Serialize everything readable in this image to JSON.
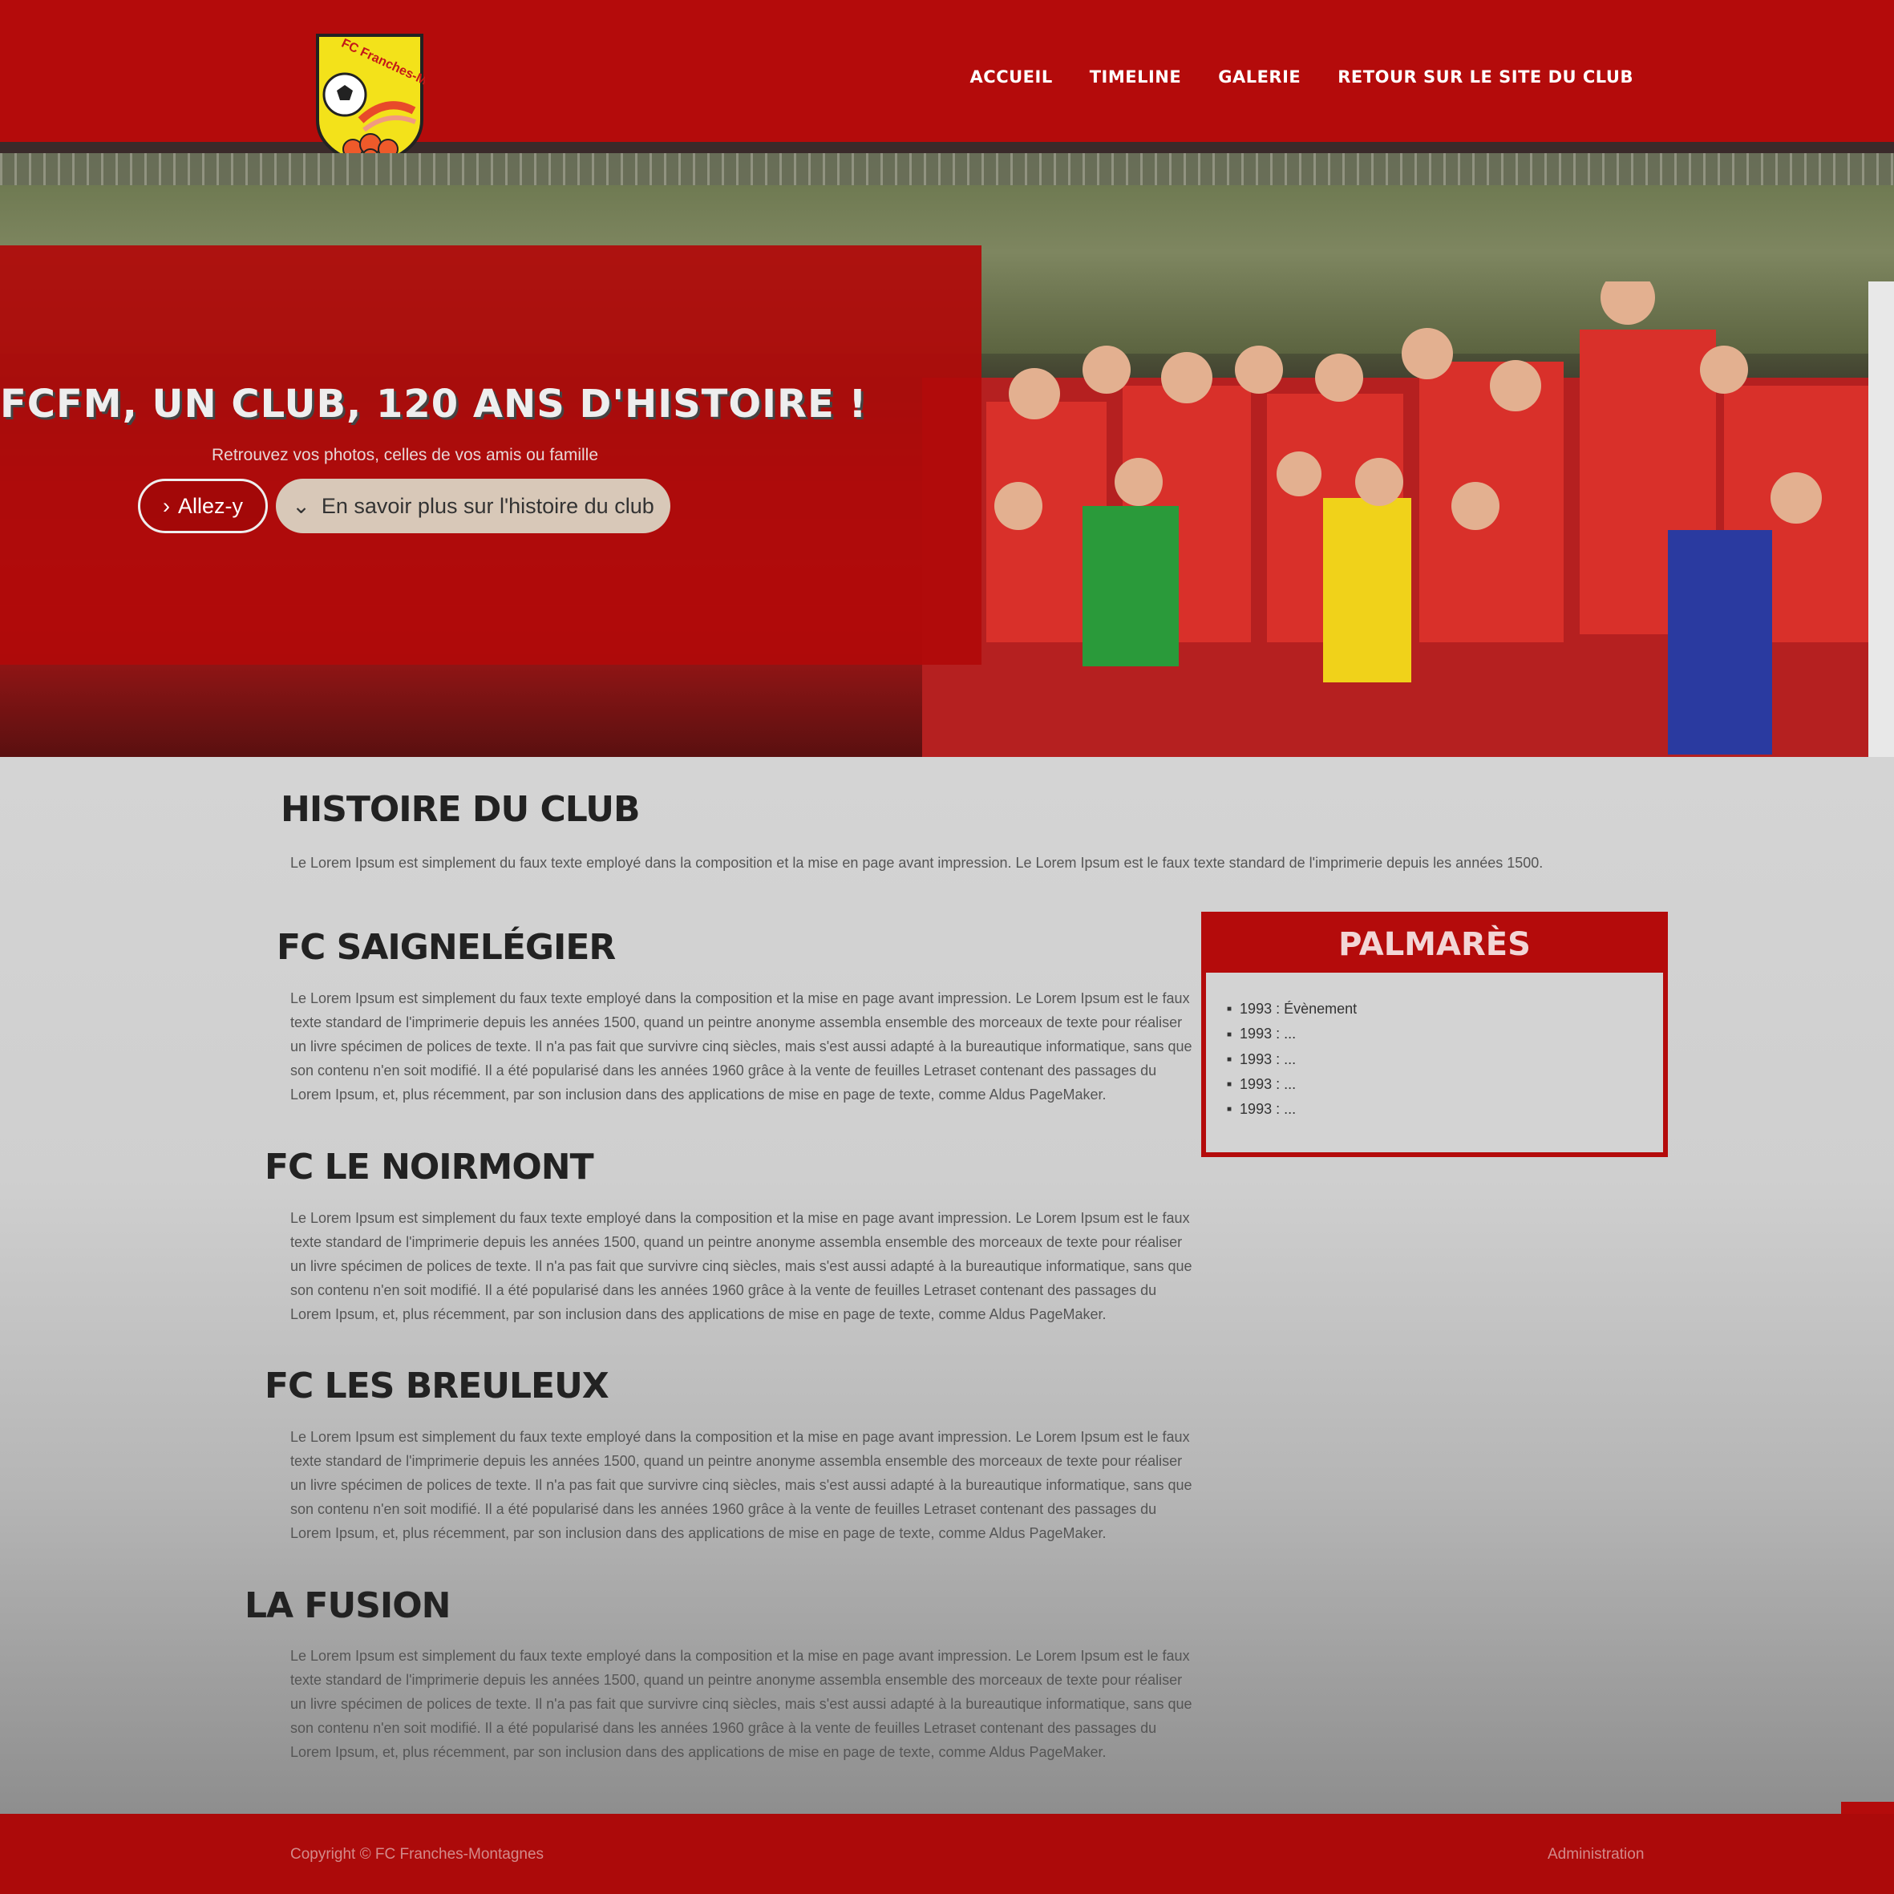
{
  "header": {
    "logo_text": "FC Franches-Montagnes",
    "nav": [
      "ACCUEIL",
      "TIMELINE",
      "GALERIE",
      "RETOUR SUR LE SITE DU CLUB"
    ]
  },
  "hero": {
    "title": "FCFM, UN CLUB, 120 ANS D'HISTOIRE !",
    "subtitle": "Retrouvez vos photos, celles de vos amis ou famille",
    "btn_go": "Allez-y",
    "btn_more": "En savoir plus sur l'histoire du club"
  },
  "content": {
    "history_title": "HISTOIRE DU CLUB",
    "history_text": "Le Lorem Ipsum est simplement du faux texte employé dans la composition et la mise en page avant impression. Le Lorem Ipsum est le faux texte standard de l'imprimerie depuis les années 1500.",
    "sections": [
      {
        "title": "FC SAIGNELÉGIER",
        "text": "Le Lorem Ipsum est simplement du faux texte employé dans la composition et la mise en page avant impression. Le Lorem Ipsum est le faux texte standard de l'imprimerie depuis les années 1500, quand un peintre anonyme assembla ensemble des morceaux de texte pour réaliser un livre spécimen de polices de texte. Il n'a pas fait que survivre cinq siècles, mais s'est aussi adapté à la bureautique informatique, sans que son contenu n'en soit modifié. Il a été popularisé dans les années 1960 grâce à la vente de feuilles Letraset contenant des passages du Lorem Ipsum, et, plus récemment, par son inclusion dans des applications de mise en page de texte, comme Aldus PageMaker."
      },
      {
        "title": "FC LE NOIRMONT",
        "text": "Le Lorem Ipsum est simplement du faux texte employé dans la composition et la mise en page avant impression. Le Lorem Ipsum est le faux texte standard de l'imprimerie depuis les années 1500, quand un peintre anonyme assembla ensemble des morceaux de texte pour réaliser un livre spécimen de polices de texte. Il n'a pas fait que survivre cinq siècles, mais s'est aussi adapté à la bureautique informatique, sans que son contenu n'en soit modifié. Il a été popularisé dans les années 1960 grâce à la vente de feuilles Letraset contenant des passages du Lorem Ipsum, et, plus récemment, par son inclusion dans des applications de mise en page de texte, comme Aldus PageMaker."
      },
      {
        "title": "FC LES BREULEUX",
        "text": "Le Lorem Ipsum est simplement du faux texte employé dans la composition et la mise en page avant impression. Le Lorem Ipsum est le faux texte standard de l'imprimerie depuis les années 1500, quand un peintre anonyme assembla ensemble des morceaux de texte pour réaliser un livre spécimen de polices de texte. Il n'a pas fait que survivre cinq siècles, mais s'est aussi adapté à la bureautique informatique, sans que son contenu n'en soit modifié. Il a été popularisé dans les années 1960 grâce à la vente de feuilles Letraset contenant des passages du Lorem Ipsum, et, plus récemment, par son inclusion dans des applications de mise en page de texte, comme Aldus PageMaker."
      },
      {
        "title": "LA FUSION",
        "text": "Le Lorem Ipsum est simplement du faux texte employé dans la composition et la mise en page avant impression. Le Lorem Ipsum est le faux texte standard de l'imprimerie depuis les années 1500, quand un peintre anonyme assembla ensemble des morceaux de texte pour réaliser un livre spécimen de polices de texte. Il n'a pas fait que survivre cinq siècles, mais s'est aussi adapté à la bureautique informatique, sans que son contenu n'en soit modifié. Il a été popularisé dans les années 1960 grâce à la vente de feuilles Letraset contenant des passages du Lorem Ipsum, et, plus récemment, par son inclusion dans des applications de mise en page de texte, comme Aldus PageMaker."
      }
    ]
  },
  "palmares": {
    "title": "PALMARÈS",
    "items": [
      "1993 : Évènement",
      "1993 : ...",
      "1993 : ...",
      "1993 : ...",
      "1993 : ..."
    ]
  },
  "footer": {
    "left": "Copyright © FC Franches-Montagnes",
    "right": "Administration"
  },
  "colors": {
    "brand": "#b40b0b",
    "footer": "#ac0a0a"
  }
}
